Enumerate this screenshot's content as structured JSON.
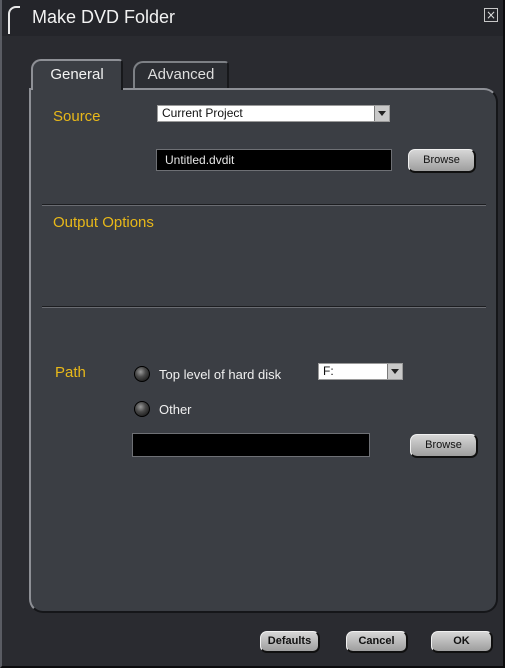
{
  "window": {
    "title": "Make DVD Folder",
    "close_symbol": "×"
  },
  "tabs": [
    {
      "label": "General",
      "active": true
    },
    {
      "label": "Advanced",
      "active": false
    }
  ],
  "source": {
    "label": "Source",
    "dropdown_value": "Current Project",
    "file_value": "Untitled.dvdit",
    "browse_label": "Browse"
  },
  "output_options": {
    "label": "Output Options"
  },
  "path": {
    "label": "Path",
    "radio_top_level_label": "Top level of hard disk",
    "drive_value": "F:",
    "radio_other_label": "Other",
    "other_value": "",
    "browse_label": "Browse"
  },
  "footer": {
    "defaults_label": "Defaults",
    "cancel_label": "Cancel",
    "ok_label": "OK"
  },
  "colors": {
    "accent": "#e8b819",
    "background": "#2a2b30",
    "panel": "#3b3e44"
  }
}
